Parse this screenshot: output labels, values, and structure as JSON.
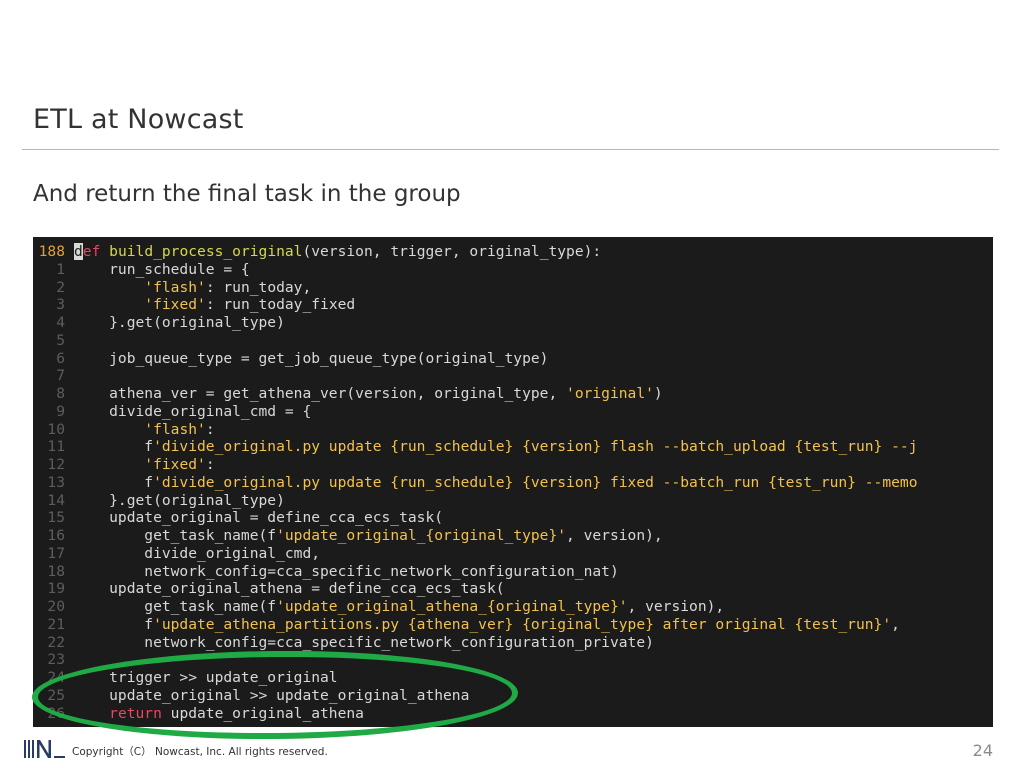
{
  "slide": {
    "title": "ETL at Nowcast",
    "subtitle": "And return the final task in the group",
    "copyright": "Copyright（C） Nowcast, Inc. All rights reserved.",
    "page_number": "24"
  },
  "code": {
    "lines": [
      {
        "n": "188",
        "current": true,
        "segs": [
          [
            "cursor",
            "d"
          ],
          [
            "kw",
            "ef"
          ],
          [
            "p",
            " "
          ],
          [
            "fn",
            "build_process_original"
          ],
          [
            "p",
            "(version, trigger, original_type):"
          ]
        ]
      },
      {
        "n": "1",
        "segs": [
          [
            "p",
            "    run_schedule = {"
          ]
        ]
      },
      {
        "n": "2",
        "segs": [
          [
            "p",
            "        "
          ],
          [
            "st",
            "'flash'"
          ],
          [
            "p",
            ": run_today,"
          ]
        ]
      },
      {
        "n": "3",
        "segs": [
          [
            "p",
            "        "
          ],
          [
            "st",
            "'fixed'"
          ],
          [
            "p",
            ": run_today_fixed"
          ]
        ]
      },
      {
        "n": "4",
        "segs": [
          [
            "p",
            "    }.get(original_type)"
          ]
        ]
      },
      {
        "n": "5",
        "segs": [
          [
            "p",
            ""
          ]
        ]
      },
      {
        "n": "6",
        "segs": [
          [
            "p",
            "    job_queue_type = get_job_queue_type(original_type)"
          ]
        ]
      },
      {
        "n": "7",
        "segs": [
          [
            "p",
            ""
          ]
        ]
      },
      {
        "n": "8",
        "segs": [
          [
            "p",
            "    athena_ver = get_athena_ver(version, original_type, "
          ],
          [
            "st",
            "'original'"
          ],
          [
            "p",
            ")"
          ]
        ]
      },
      {
        "n": "9",
        "segs": [
          [
            "p",
            "    divide_original_cmd = {"
          ]
        ]
      },
      {
        "n": "10",
        "segs": [
          [
            "p",
            "        "
          ],
          [
            "st",
            "'flash'"
          ],
          [
            "p",
            ":"
          ]
        ]
      },
      {
        "n": "11",
        "segs": [
          [
            "p",
            "        f"
          ],
          [
            "st",
            "'divide_original.py update {run_schedule} {version} flash --batch_upload {test_run} --j"
          ]
        ]
      },
      {
        "n": "12",
        "segs": [
          [
            "p",
            "        "
          ],
          [
            "st",
            "'fixed'"
          ],
          [
            "p",
            ":"
          ]
        ]
      },
      {
        "n": "13",
        "segs": [
          [
            "p",
            "        f"
          ],
          [
            "st",
            "'divide_original.py update {run_schedule} {version} fixed --batch_run {test_run} --memo"
          ]
        ]
      },
      {
        "n": "14",
        "segs": [
          [
            "p",
            "    }.get(original_type)"
          ]
        ]
      },
      {
        "n": "15",
        "segs": [
          [
            "p",
            "    update_original = define_cca_ecs_task("
          ]
        ]
      },
      {
        "n": "16",
        "segs": [
          [
            "p",
            "        get_task_name(f"
          ],
          [
            "st",
            "'update_original_{original_type}'"
          ],
          [
            "p",
            ", version),"
          ]
        ]
      },
      {
        "n": "17",
        "segs": [
          [
            "p",
            "        divide_original_cmd,"
          ]
        ]
      },
      {
        "n": "18",
        "segs": [
          [
            "p",
            "        network_config=cca_specific_network_configuration_nat)"
          ]
        ]
      },
      {
        "n": "19",
        "segs": [
          [
            "p",
            "    update_original_athena = define_cca_ecs_task("
          ]
        ]
      },
      {
        "n": "20",
        "segs": [
          [
            "p",
            "        get_task_name(f"
          ],
          [
            "st",
            "'update_original_athena_{original_type}'"
          ],
          [
            "p",
            ", version),"
          ]
        ]
      },
      {
        "n": "21",
        "segs": [
          [
            "p",
            "        f"
          ],
          [
            "st",
            "'update_athena_partitions.py {athena_ver} {original_type} after original {test_run}'"
          ],
          [
            "p",
            ","
          ]
        ]
      },
      {
        "n": "22",
        "segs": [
          [
            "p",
            "        network_config=cca_specific_network_configuration_private)"
          ]
        ]
      },
      {
        "n": "23",
        "segs": [
          [
            "p",
            ""
          ]
        ]
      },
      {
        "n": "24",
        "segs": [
          [
            "p",
            "    trigger >> update_original"
          ]
        ]
      },
      {
        "n": "25",
        "segs": [
          [
            "p",
            "    update_original >> update_original_athena"
          ]
        ]
      },
      {
        "n": "26",
        "segs": [
          [
            "p",
            "    "
          ],
          [
            "kw",
            "return"
          ],
          [
            "p",
            " update_original_athena"
          ]
        ]
      }
    ]
  },
  "colors": {
    "editor_bg": "#1b1b1b",
    "keyword": "#e8475f",
    "function": "#d6d84a",
    "string": "#f2c14e",
    "highlight_ellipse": "#1faa46",
    "rule": "#8fc9b8"
  },
  "icons": {
    "logo": "nowcast-logo-icon"
  }
}
